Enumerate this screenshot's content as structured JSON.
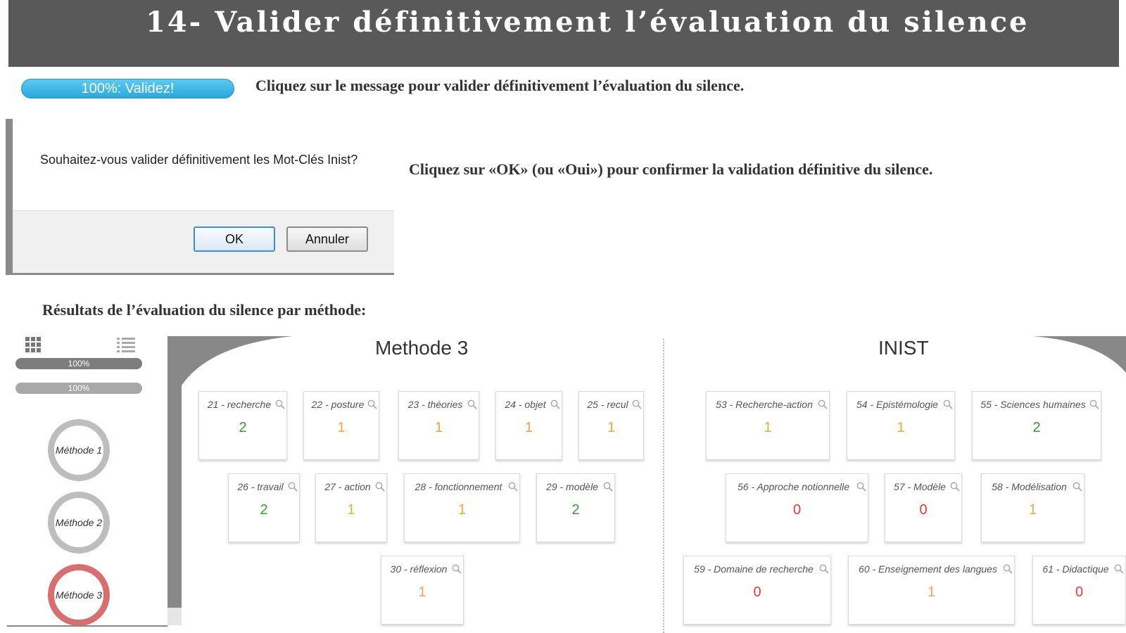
{
  "banner": {
    "title": "14- Valider définitivement l’évaluation du silence"
  },
  "progress": {
    "label": "100%: Validez!",
    "value": 100
  },
  "instructions": {
    "step1": "Cliquez sur le message pour valider définitivement l’évaluation du silence.",
    "step2": "Cliquez sur «OK» (ou «Oui») pour confirmer la validation définitive du silence.",
    "results_heading": "Résultats de l’évaluation du silence par méthode:"
  },
  "dialog": {
    "message": "Souhaitez-vous valider définitivement les Mot-Clés Inist?",
    "ok_label": "OK",
    "cancel_label": "Annuler"
  },
  "sidebar": {
    "bars": [
      {
        "label": "100%"
      },
      {
        "label": "100%"
      }
    ],
    "methods": [
      {
        "label": "Méthode 1"
      },
      {
        "label": "Méthode 2"
      },
      {
        "label": "Méthode 3"
      }
    ]
  },
  "colors": {
    "green": "#3a9a3a",
    "orange": "#f2a93b",
    "red": "#e83a3a",
    "selected_ring": "#d86f6f",
    "ring": "#bdbdbd",
    "pill": "#29a8dd"
  },
  "sections": {
    "methode3": {
      "title": "Methode 3",
      "keywords": [
        {
          "label": "21 - recherche",
          "count": "2",
          "color": "green"
        },
        {
          "label": "22 - posture",
          "count": "1",
          "color": "orange"
        },
        {
          "label": "23 - théories",
          "count": "1",
          "color": "orange"
        },
        {
          "label": "24 - objet",
          "count": "1",
          "color": "orange"
        },
        {
          "label": "25 - recul",
          "count": "1",
          "color": "orange"
        },
        {
          "label": "26 - travail",
          "count": "2",
          "color": "green"
        },
        {
          "label": "27 - action",
          "count": "1",
          "color": "orange"
        },
        {
          "label": "28 - fonctionnement",
          "count": "1",
          "color": "orange"
        },
        {
          "label": "29 - modèle",
          "count": "2",
          "color": "green"
        },
        {
          "label": "30 - réflexion",
          "count": "1",
          "color": "orange"
        }
      ]
    },
    "inist": {
      "title": "INIST",
      "keywords": [
        {
          "label": "53 - Recherche-action",
          "count": "1",
          "color": "orange"
        },
        {
          "label": "54 - Epistémologie",
          "count": "1",
          "color": "orange"
        },
        {
          "label": "55 - Sciences humaines",
          "count": "2",
          "color": "green"
        },
        {
          "label": "56 - Approche notionnelle",
          "count": "0",
          "color": "red"
        },
        {
          "label": "57 - Modèle",
          "count": "0",
          "color": "red"
        },
        {
          "label": "58 - Modélisation",
          "count": "1",
          "color": "orange"
        },
        {
          "label": "59 - Domaine de recherche",
          "count": "0",
          "color": "red"
        },
        {
          "label": "60 - Enseignement des langues",
          "count": "1",
          "color": "orange"
        },
        {
          "label": "61 - Didactique",
          "count": "0",
          "color": "red"
        }
      ]
    }
  }
}
